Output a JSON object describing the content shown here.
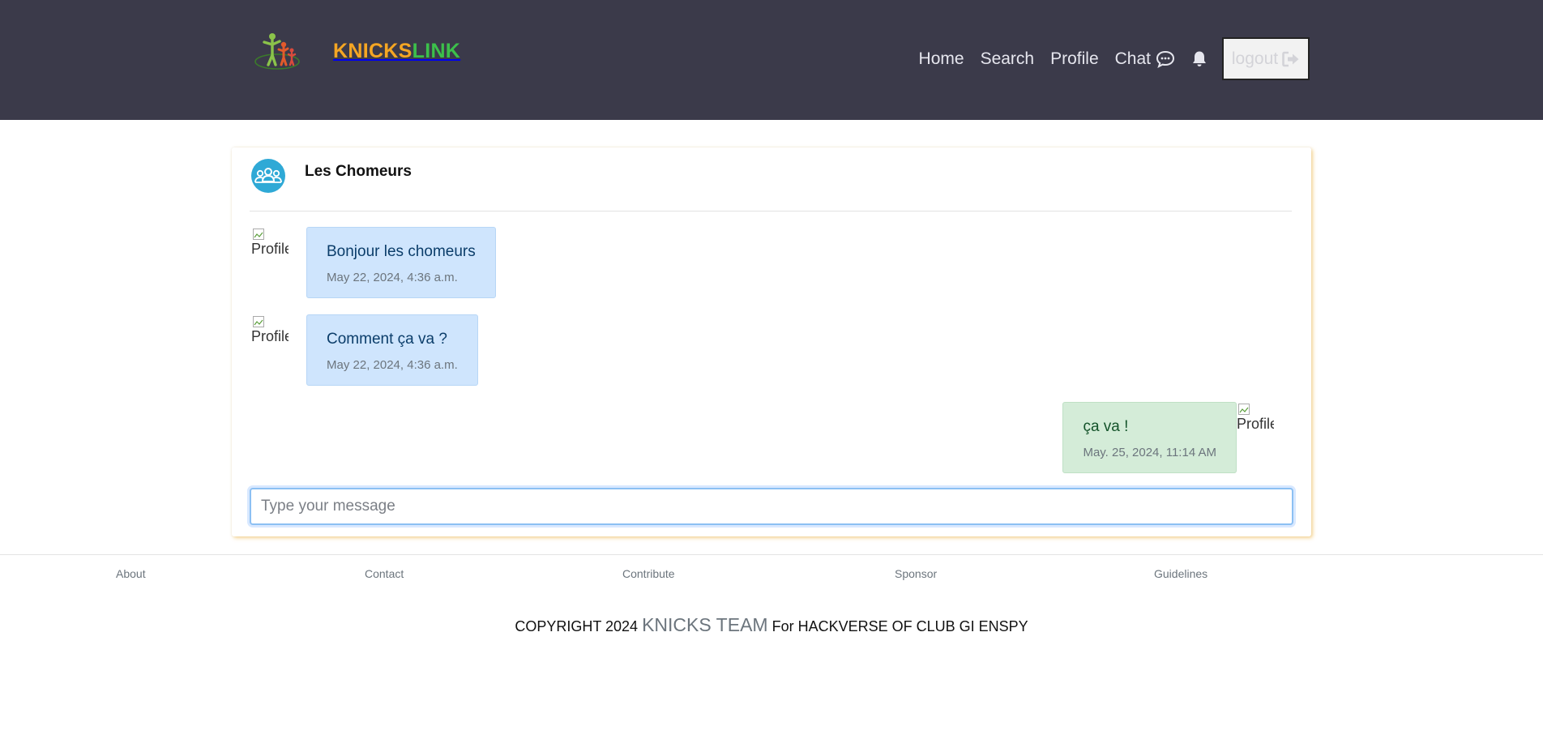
{
  "brand": {
    "part1": "KNICKS",
    "part2": "LINK"
  },
  "nav": {
    "home": "Home",
    "search": "Search",
    "profile": "Profile",
    "chat": "Chat",
    "logout": "logout"
  },
  "chat": {
    "group_name": "Les Chomeurs",
    "avatar_alt": "Profile",
    "messages": [
      {
        "text": "Bonjour les chomeurs",
        "time": "May 22, 2024, 4:36 a.m.",
        "direction": "incoming"
      },
      {
        "text": "Comment ça va ?",
        "time": "May 22, 2024, 4:36 a.m.",
        "direction": "incoming"
      },
      {
        "text": "ça va !",
        "time": "May. 25, 2024, 11:14 AM",
        "direction": "outgoing"
      }
    ],
    "input_placeholder": "Type your message"
  },
  "footer": {
    "links": [
      "About",
      "Contact",
      "Contribute",
      "Sponsor",
      "Guidelines"
    ],
    "copyright_prefix": "COPYRIGHT 2024",
    "team": "KNICKS TEAM",
    "copyright_suffix": "For HACKVERSE OF CLUB GI ENSPY"
  },
  "colors": {
    "navbar_bg": "#3b3a4a",
    "brand_orange": "#f5a623",
    "brand_green": "#3cc04b",
    "incoming_bubble": "#cfe5fd",
    "outgoing_bubble": "#d4ecd8",
    "group_avatar": "#2fa9d6"
  },
  "icons": [
    "knickslink-logo",
    "chat-bubble-icon",
    "bell-icon",
    "sign-out-icon",
    "group-icon",
    "broken-image-icon"
  ]
}
